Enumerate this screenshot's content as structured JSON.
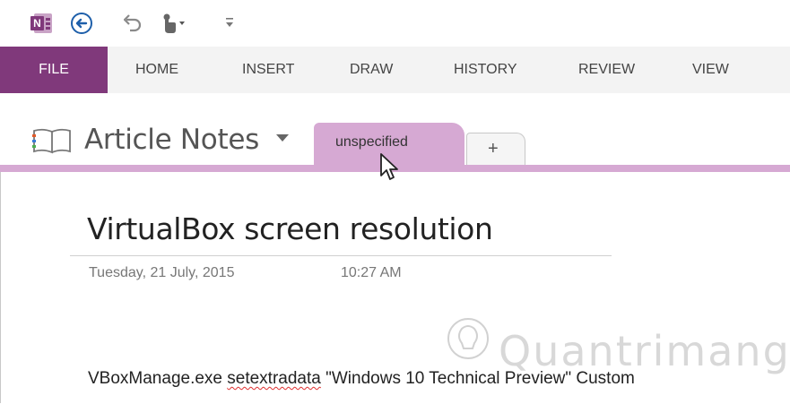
{
  "ribbon": {
    "tabs": [
      {
        "label": "FILE"
      },
      {
        "label": "HOME"
      },
      {
        "label": "INSERT"
      },
      {
        "label": "DRAW"
      },
      {
        "label": "HISTORY"
      },
      {
        "label": "REVIEW"
      },
      {
        "label": "VIEW"
      }
    ]
  },
  "notebook": {
    "name": "Article Notes",
    "active_section": "unspecified",
    "add_section_symbol": "+"
  },
  "page": {
    "title": "VirtualBox screen resolution",
    "date": "Tuesday, 21 July, 2015",
    "time": "10:27 AM",
    "body": {
      "before": "VBoxManage.exe ",
      "misspelled": "setextradata",
      "after": " \"Windows 10 Technical Preview\" Custom"
    }
  },
  "watermark": {
    "text": "Quantrimang"
  },
  "colors": {
    "file_tab": "#80397b",
    "section_tab": "#d6a9d3",
    "app_icon": "#80397b",
    "back_button": "#1e5faa"
  },
  "icons": [
    "onenote-app-icon",
    "back-arrow-icon",
    "undo-icon",
    "touch-mode-icon",
    "customize-qat-icon",
    "notebook-icon",
    "notebook-dropdown-icon",
    "mouse-pointer-icon",
    "watermark-bulb-icon"
  ]
}
